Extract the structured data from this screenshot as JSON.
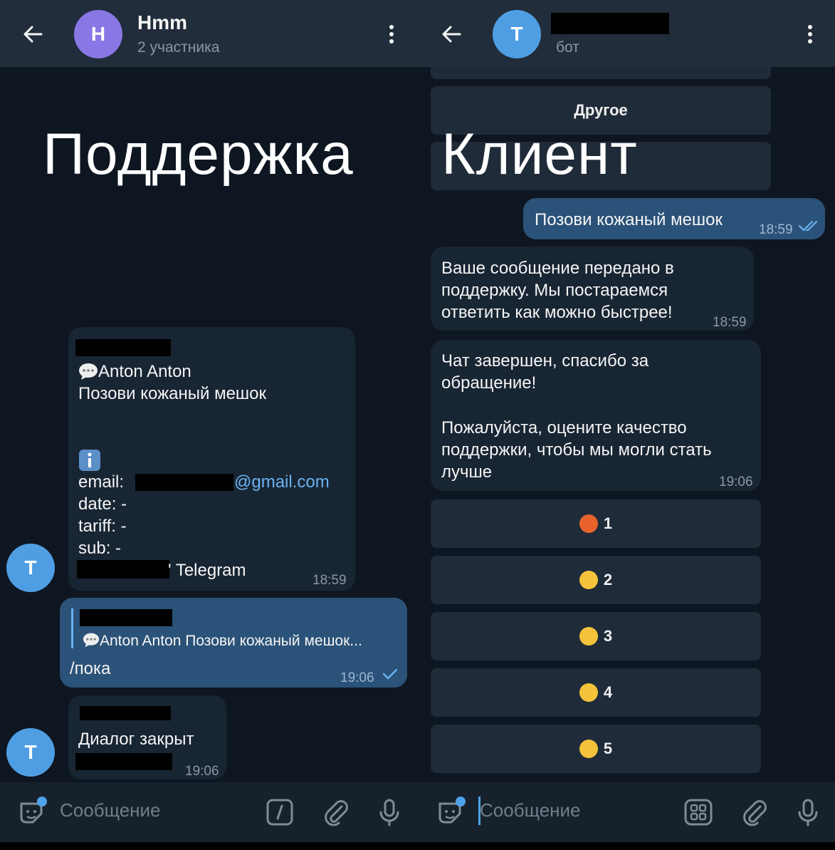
{
  "left": {
    "header": {
      "title": "Hmm",
      "subtitle": "2 участника",
      "avatar_letter": "H",
      "avatar_color": "#8a77e6"
    },
    "overlay_label": "Поддержка",
    "messages": {
      "ticket": {
        "author": "Anton Anton",
        "text": "Позови кожаный мешок",
        "email_label": "email:",
        "email_domain": "@gmail.com",
        "date": "date: -",
        "tariff": "tariff: -",
        "sub": "sub: -",
        "source_suffix": "' Telegram",
        "time": "18:59",
        "sender_avatar": "T"
      },
      "reply": {
        "quote": "Anton Anton Позови кожаный мешок...",
        "text": "/пока",
        "time": "19:06"
      },
      "closed": {
        "text": "Диалог закрыт",
        "time": "19:06",
        "sender_avatar": "T"
      }
    },
    "composer": {
      "placeholder": "Сообщение"
    }
  },
  "right": {
    "header": {
      "subtitle": "бот",
      "avatar_letter": "T",
      "avatar_color": "#4f9ee4"
    },
    "overlay_label": "Клиент",
    "keyboard_top": {
      "other_label": "Другое"
    },
    "messages": {
      "sent": {
        "text": "Позови кожаный мешок",
        "time": "18:59"
      },
      "bot1": {
        "text": "Ваше сообщение передано в поддержку. Мы постараемся ответить как можно быстрее!",
        "time": "18:59"
      },
      "bot2": {
        "line1": "Чат завершен, спасибо за обращение!",
        "line2": "Пожалуйста, оцените качество поддержки, чтобы мы могли стать лучше",
        "time": "19:06"
      }
    },
    "rating_buttons": [
      {
        "label": "1",
        "icon": "angry-face-icon"
      },
      {
        "label": "2",
        "icon": "frowning-face-icon"
      },
      {
        "label": "3",
        "icon": "neutral-face-icon"
      },
      {
        "label": "4",
        "icon": "slight-smile-icon"
      },
      {
        "label": "5",
        "icon": "grinning-face-icon"
      }
    ],
    "composer": {
      "placeholder": "Сообщение"
    }
  },
  "colors": {
    "background": "#0e1621",
    "header": "#212d3b",
    "bubble_in": "#182533",
    "bubble_out": "#2b5278",
    "link": "#6ab3f3",
    "accent": "#4fa3e8"
  }
}
